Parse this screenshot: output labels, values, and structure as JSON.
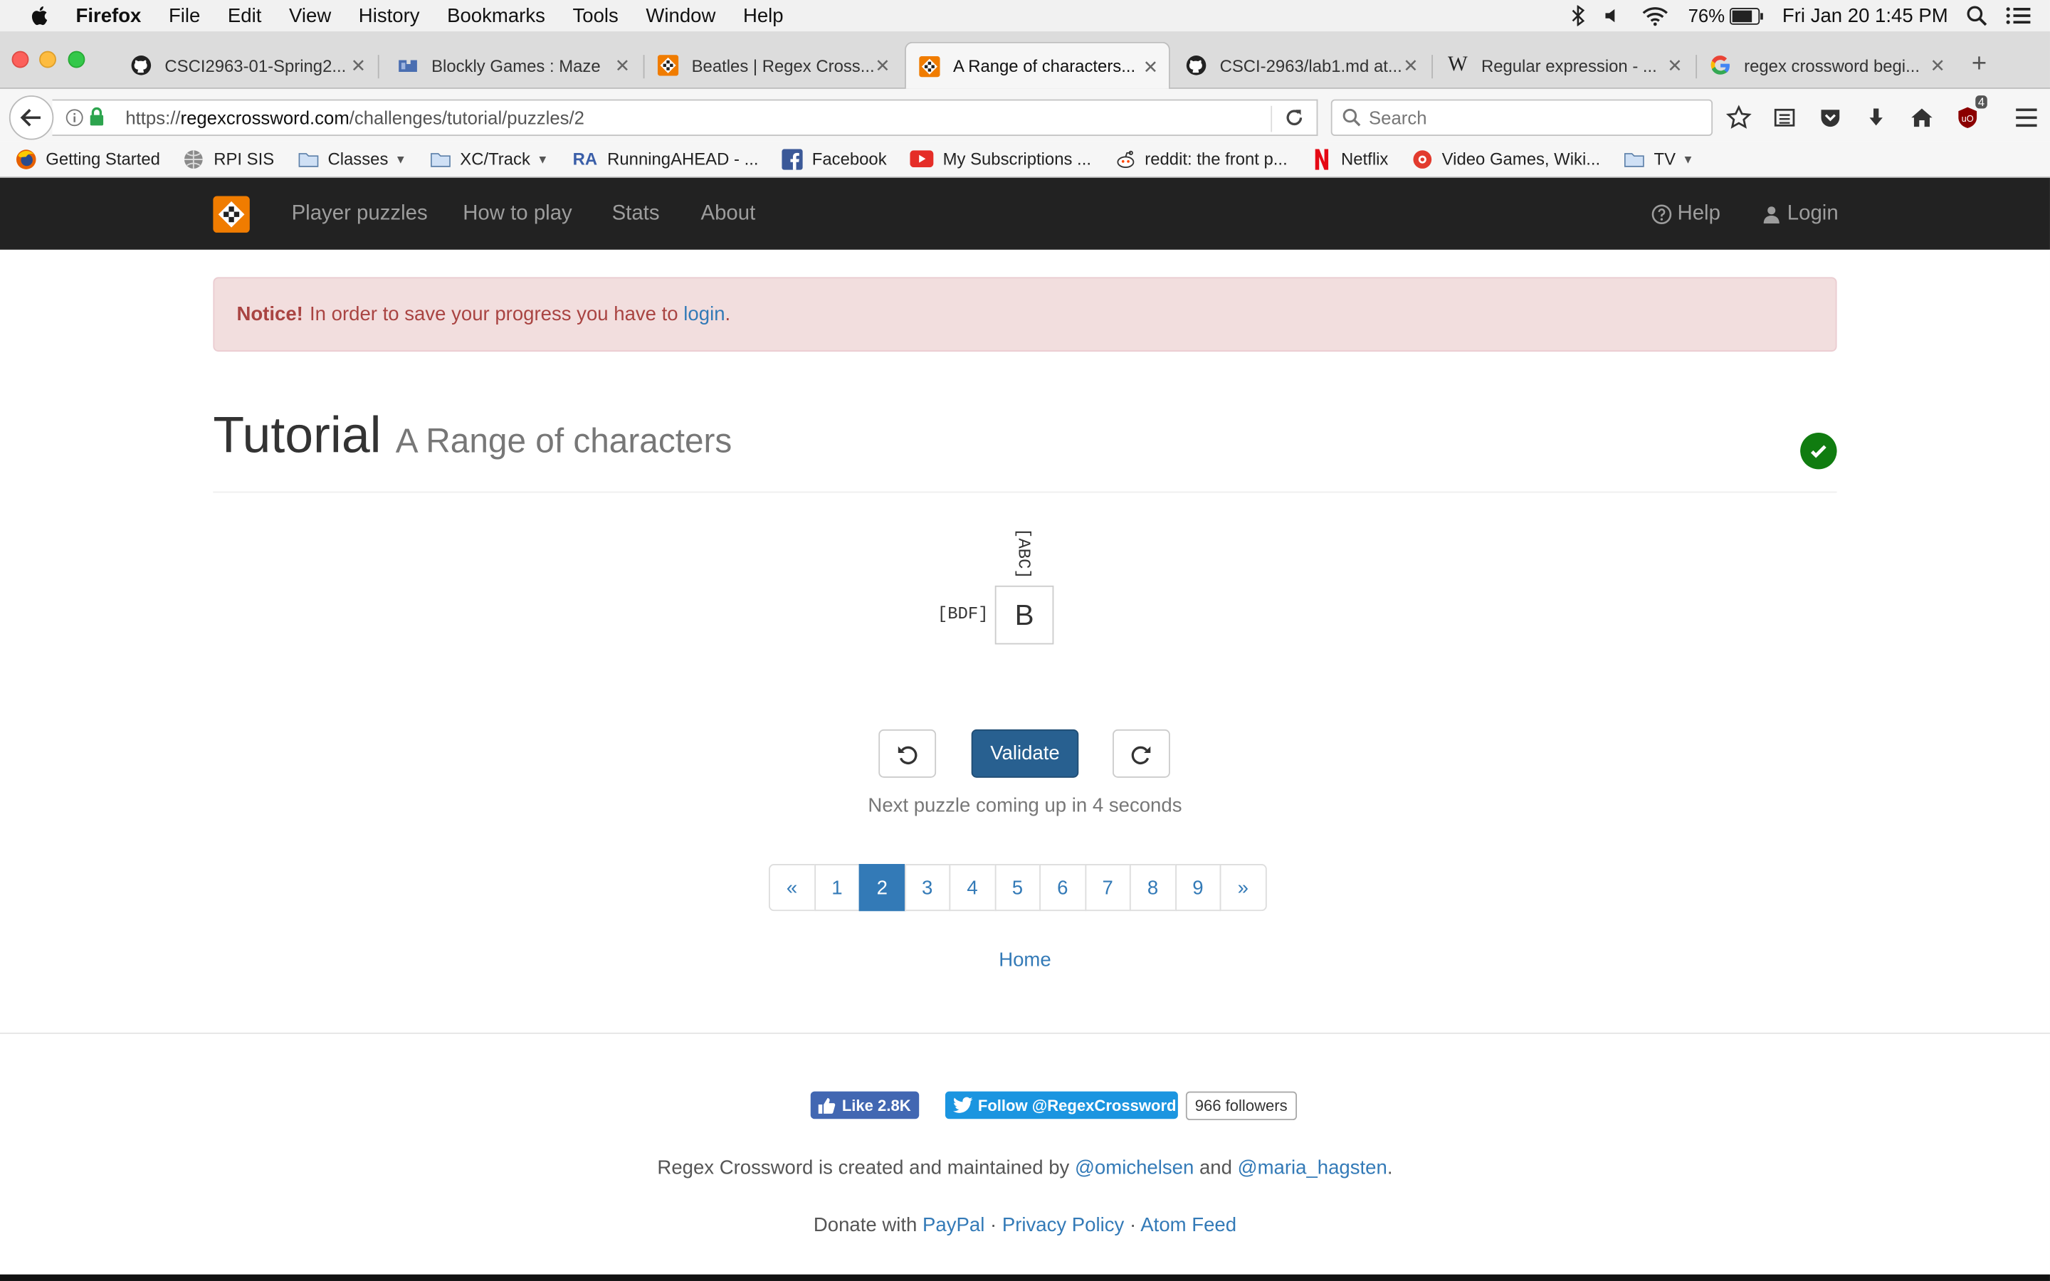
{
  "menubar": {
    "app": "Firefox",
    "items": [
      "File",
      "Edit",
      "View",
      "History",
      "Bookmarks",
      "Tools",
      "Window",
      "Help"
    ],
    "battery": "76%",
    "datetime": "Fri Jan 20  1:45 PM"
  },
  "tabs": [
    {
      "title": "CSCI2963-01-Spring2...",
      "icon": "github-icon"
    },
    {
      "title": "Blockly Games : Maze",
      "icon": "blockly-icon"
    },
    {
      "title": "Beatles | Regex Cross...",
      "icon": "regexcrossword-icon"
    },
    {
      "title": "A Range of characters...",
      "icon": "regexcrossword-icon",
      "active": true
    },
    {
      "title": "CSCI-2963/lab1.md at...",
      "icon": "github-icon"
    },
    {
      "title": "Regular expression - ...",
      "icon": "wikipedia-icon"
    },
    {
      "title": "regex crossword begi...",
      "icon": "google-icon"
    }
  ],
  "urlbar": {
    "scheme": "https://",
    "host": "regexcrossword.com",
    "path": "/challenges/tutorial/puzzles/2"
  },
  "search": {
    "placeholder": "Search"
  },
  "toolbar": {
    "ublock_badge": "4"
  },
  "bookmarks": [
    {
      "label": "Getting Started",
      "icon": "firefox-icon"
    },
    {
      "label": "RPI SIS",
      "icon": "globe-icon"
    },
    {
      "label": "Classes",
      "icon": "folder-icon",
      "folder": true
    },
    {
      "label": "XC/Track",
      "icon": "folder-icon",
      "folder": true
    },
    {
      "label": "RunningAHEAD - ...",
      "icon": "ra-icon"
    },
    {
      "label": "Facebook",
      "icon": "facebook-icon"
    },
    {
      "label": "My Subscriptions ...",
      "icon": "youtube-icon"
    },
    {
      "label": "reddit: the front p...",
      "icon": "reddit-icon"
    },
    {
      "label": "Netflix",
      "icon": "netflix-icon"
    },
    {
      "label": "Video Games, Wiki...",
      "icon": "giantbomb-icon"
    },
    {
      "label": "TV",
      "icon": "folder-icon",
      "folder": true
    }
  ],
  "sitenav": {
    "links": [
      "Player puzzles",
      "How to play",
      "Stats",
      "About"
    ],
    "help": "Help",
    "login": "Login"
  },
  "notice": {
    "strong": "Notice!",
    "text": "In order to save your progress you have to",
    "link": "login",
    "end": "."
  },
  "page": {
    "title": "Tutorial",
    "subtitle": "A Range of characters"
  },
  "puzzle": {
    "column_clue": "[ABC]",
    "row_clue": "[BDF]",
    "cell_value": "B"
  },
  "buttons": {
    "validate": "Validate"
  },
  "next_message": "Next puzzle coming up in 4 seconds",
  "pagination": {
    "prev": "«",
    "pages": [
      "1",
      "2",
      "3",
      "4",
      "5",
      "6",
      "7",
      "8",
      "9"
    ],
    "current": "2",
    "next": "»"
  },
  "home_link": "Home",
  "social": {
    "fb_like": "Like 2.8K",
    "twitter_follow": "Follow @RegexCrossword",
    "twitter_followers": "966 followers"
  },
  "footer": {
    "credits_prefix": "Regex Crossword is created and maintained by",
    "author1": "@omichelsen",
    "and": "and",
    "author2": "@maria_hagsten",
    "donate_prefix": "Donate with",
    "paypal": "PayPal",
    "privacy": "Privacy Policy",
    "atom": "Atom Feed"
  },
  "colors": {
    "site_nav": "#222222",
    "brand_orange": "#f07c00",
    "link": "#337ab7",
    "validate": "#286090",
    "solved": "#107c10"
  }
}
